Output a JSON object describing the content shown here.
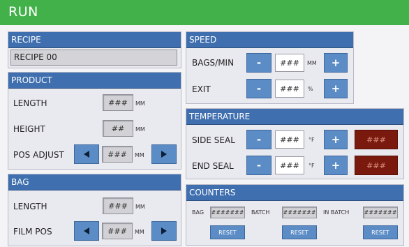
{
  "app": {
    "title": "RUN"
  },
  "recipe": {
    "header": "RECIPE",
    "value": "RECIPE 00"
  },
  "product": {
    "header": "PRODUCT",
    "length": {
      "label": "LENGTH",
      "value": "###",
      "unit": "MM"
    },
    "height": {
      "label": "HEIGHT",
      "value": "##",
      "unit": "MM"
    },
    "pos_adjust": {
      "label": "POS ADJUST",
      "value": "###",
      "unit": "MM"
    }
  },
  "bag": {
    "header": "BAG",
    "length": {
      "label": "LENGTH",
      "value": "###",
      "unit": "MM"
    },
    "film_pos": {
      "label": "FILM POS",
      "value": "###",
      "unit": "MM"
    }
  },
  "speed": {
    "header": "SPEED",
    "bags_min": {
      "label": "BAGS/MIN",
      "value": "###",
      "unit": "MM"
    },
    "exit": {
      "label": "EXIT",
      "value": "###",
      "unit": "%"
    },
    "minus": "-",
    "plus": "+"
  },
  "temperature": {
    "header": "TEMPERATURE",
    "side_seal": {
      "label": "SIDE SEAL",
      "value": "###",
      "unit": "°F",
      "actual": "###"
    },
    "end_seal": {
      "label": "END SEAL",
      "value": "###",
      "unit": "°F",
      "actual": "###"
    },
    "minus": "-",
    "plus": "+"
  },
  "counters": {
    "header": "COUNTERS",
    "bag": {
      "label": "BAG",
      "value": "#######"
    },
    "batch": {
      "label": "BATCH",
      "value": "#######"
    },
    "in_batch": {
      "label": "IN BATCH",
      "value": "#######"
    },
    "reset_label": "RESET"
  },
  "colors": {
    "title_bar": "#43b14a",
    "panel_header": "#3f6fae",
    "button": "#5b8cc6",
    "actual_temp": "#7a1a0e"
  }
}
